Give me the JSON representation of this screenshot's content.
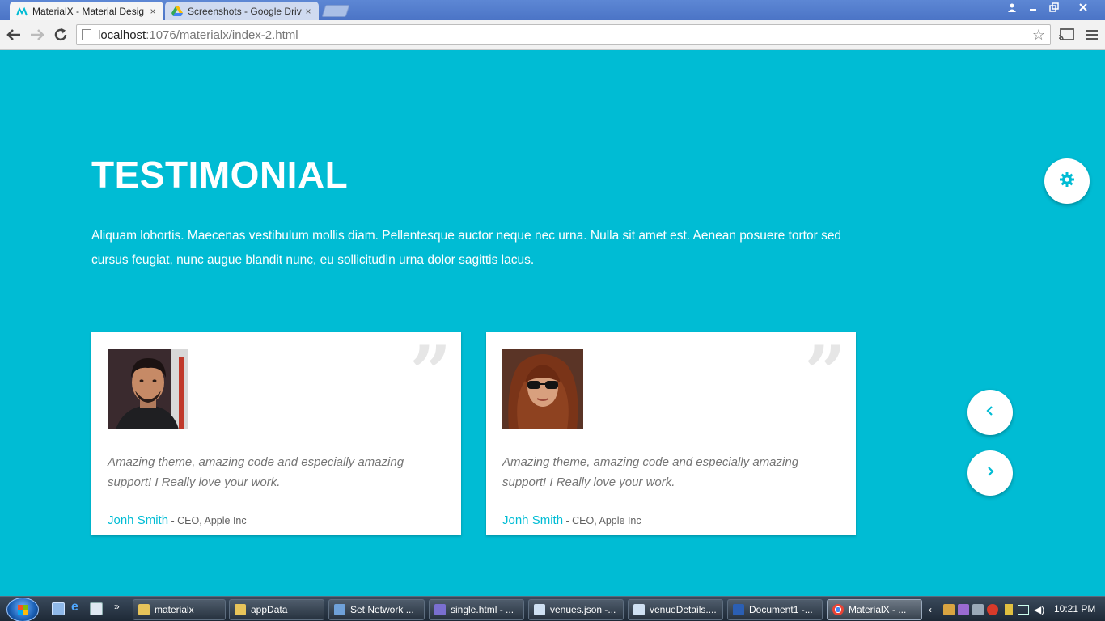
{
  "browser": {
    "tabs": [
      {
        "title": "MaterialX - Material Desig",
        "active": true,
        "favicon": "materialx-logo-icon"
      },
      {
        "title": "Screenshots - Google Driv",
        "active": false,
        "favicon": "google-drive-icon"
      }
    ],
    "close_glyph": "×",
    "url_host": "localhost",
    "url_rest": ":1076/materialx/index-2.html"
  },
  "section": {
    "title": "TESTIMONIAL",
    "intro": "Aliquam lobortis. Maecenas vestibulum mollis diam. Pellentesque auctor neque nec urna. Nulla sit amet est. Aenean posuere tortor sed cursus feugiat, nunc augue blandit nunc, eu sollicitudin urna dolor sagittis lacus."
  },
  "testimonials": [
    {
      "quote": "Amazing theme, amazing code and especially amazing support! I Really love your work.",
      "name": "Jonh Smith",
      "role": " - CEO, Apple Inc",
      "avatar": "man-portrait"
    },
    {
      "quote": "Amazing theme, amazing code and especially amazing support! I Really love your work.",
      "name": "Jonh Smith",
      "role": " - CEO, Apple Inc",
      "avatar": "woman-portrait"
    }
  ],
  "quote_glyph": "”",
  "colors": {
    "accent": "#00bcd4",
    "card": "#ffffff",
    "quote_text": "#757575"
  },
  "taskbar": {
    "items": [
      {
        "label": "materialx",
        "icon": "folder-icon",
        "active": false
      },
      {
        "label": "appData",
        "icon": "folder-icon",
        "active": false
      },
      {
        "label": "Set Network ...",
        "icon": "network-icon",
        "active": false
      },
      {
        "label": "single.html - ...",
        "icon": "editor-icon",
        "active": false
      },
      {
        "label": "venues.json -...",
        "icon": "notepad-icon",
        "active": false
      },
      {
        "label": "venueDetails....",
        "icon": "notepad-icon",
        "active": false
      },
      {
        "label": "Document1 -...",
        "icon": "word-icon",
        "active": false
      },
      {
        "label": "MaterialX - ...",
        "icon": "chrome-icon",
        "active": true
      }
    ],
    "clock": "10:21 PM"
  }
}
